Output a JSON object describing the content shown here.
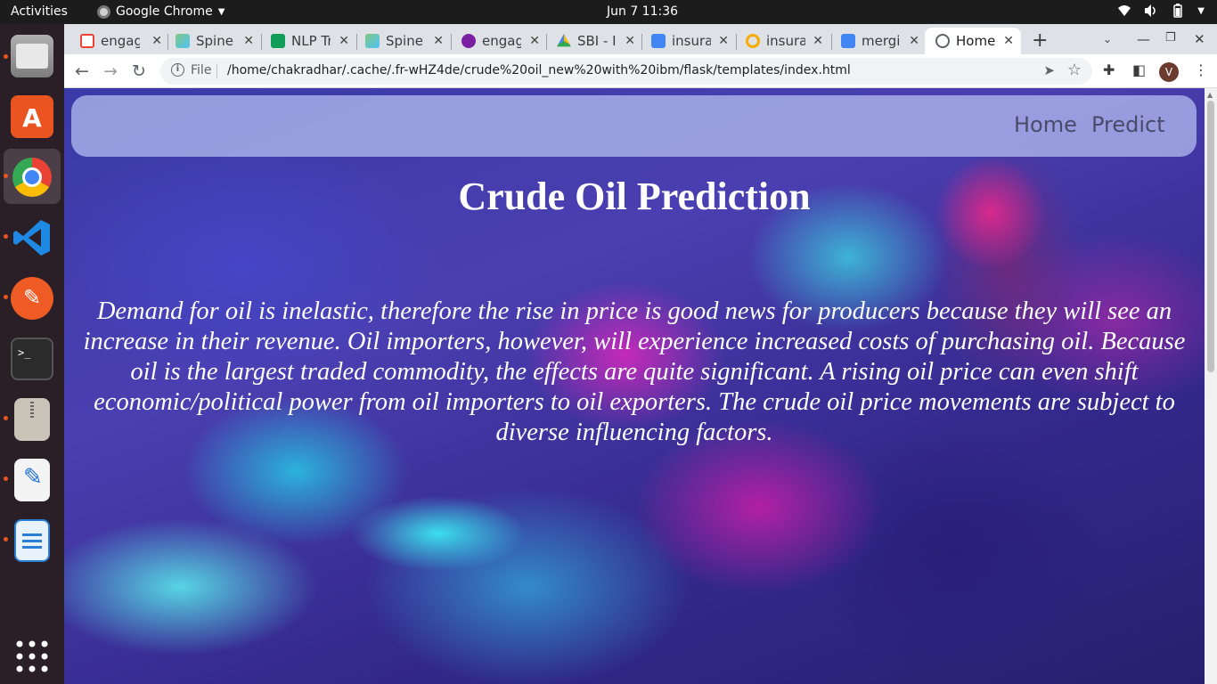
{
  "topbar": {
    "activities": "Activities",
    "app_name": "Google Chrome",
    "clock": "Jun 7  11:36"
  },
  "dock": {
    "items": [
      "files-icon",
      "app-center-icon",
      "chrome-icon",
      "vscode-icon",
      "postman-icon",
      "terminal-icon",
      "archive-icon",
      "text-editor-icon",
      "writer-icon",
      "show-apps-icon"
    ]
  },
  "browser": {
    "tabs": [
      {
        "label": "engag",
        "icon": "gmail-icon",
        "color": "#ea4335"
      },
      {
        "label": "Spine",
        "icon": "spine-icon",
        "color": "#4caf50"
      },
      {
        "label": "NLP Tr",
        "icon": "sheets-icon",
        "color": "#0f9d58"
      },
      {
        "label": "Spine",
        "icon": "spine-icon",
        "color": "#4caf50"
      },
      {
        "label": "engag",
        "icon": "engage-icon",
        "color": "#7b1fa2"
      },
      {
        "label": "SBI - Ir",
        "icon": "drive-icon",
        "color": "#fbbc04"
      },
      {
        "label": "insura",
        "icon": "docs-icon",
        "color": "#4285f4"
      },
      {
        "label": "insura",
        "icon": "colab-icon",
        "color": "#f9ab00"
      },
      {
        "label": "mergi",
        "icon": "docs-icon",
        "color": "#4285f4"
      },
      {
        "label": "Home",
        "icon": "globe-icon",
        "color": "#5f6368",
        "active": true
      }
    ],
    "omnibox": {
      "scheme": "File",
      "url": "/home/chakradhar/.cache/.fr-wHZ4de/crude%20oil_new%20with%20ibm/flask/templates/index.html"
    },
    "profile_initial": "V"
  },
  "page": {
    "nav": {
      "home": "Home",
      "predict": "Predict"
    },
    "title": "Crude Oil Prediction",
    "description": "Demand for oil is inelastic, therefore the rise in price is good news for producers because they will see an increase in their revenue. Oil importers, however, will experience increased costs of purchasing oil. Because oil is the largest traded commodity, the effects are quite significant. A rising oil price can even shift economic/political power from oil importers to oil exporters. The crude oil price movements are subject to diverse influencing factors."
  }
}
